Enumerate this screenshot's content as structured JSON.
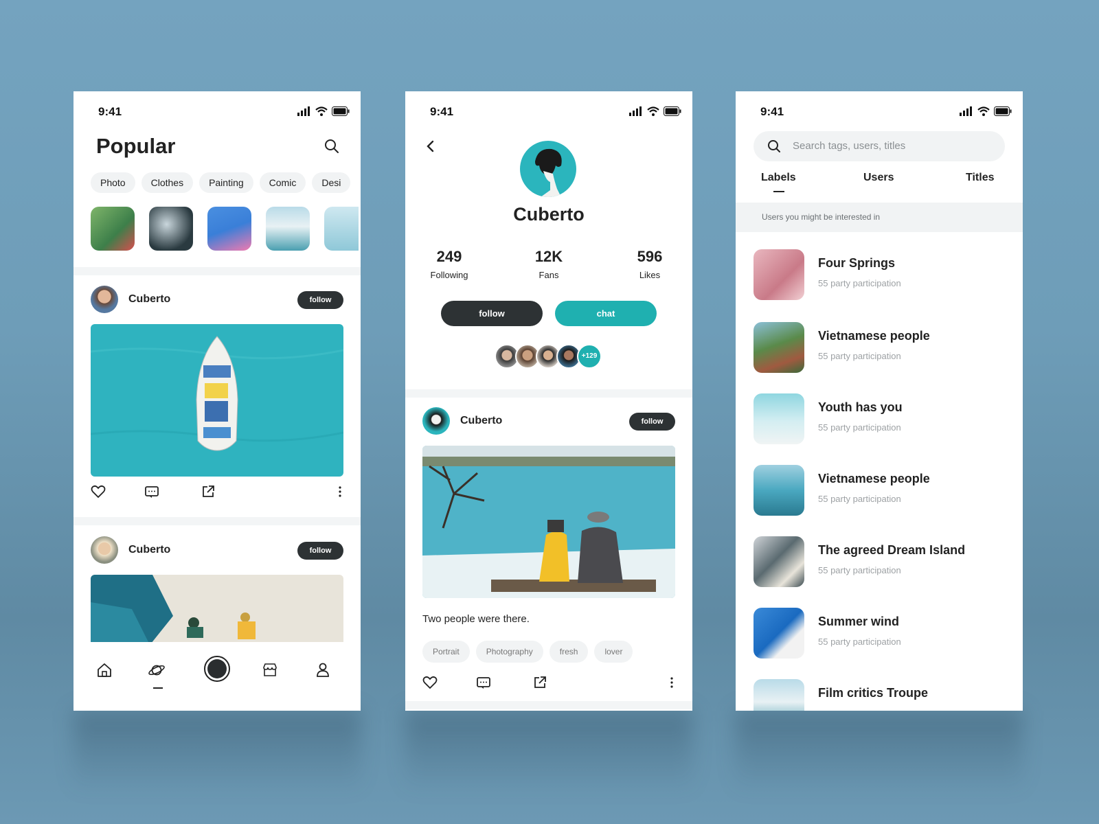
{
  "status": {
    "time": "9:41"
  },
  "screen1": {
    "title": "Popular",
    "chips": [
      "Photo",
      "Clothes",
      "Painting",
      "Comic",
      "Desi"
    ],
    "posts": [
      {
        "name": "Cuberto",
        "follow": "follow"
      },
      {
        "name": "Cuberto",
        "follow": "follow"
      }
    ]
  },
  "screen2": {
    "name": "Cuberto",
    "stats": [
      {
        "value": "249",
        "label": "Following"
      },
      {
        "value": "12K",
        "label": "Fans"
      },
      {
        "value": "596",
        "label": "Likes"
      }
    ],
    "follow_label": "follow",
    "chat_label": "chat",
    "followers_more": "+129",
    "post": {
      "name": "Cuberto",
      "follow": "follow",
      "caption": "Two people were there.",
      "tags": [
        "Portrait",
        "Photography",
        "fresh",
        "lover"
      ]
    }
  },
  "screen3": {
    "search_placeholder": "Search tags, users, titles",
    "tabs": [
      "Labels",
      "Users",
      "Titles"
    ],
    "banner": "Users you might be interested in",
    "items": [
      {
        "title": "Four Springs",
        "sub": "55 party participation"
      },
      {
        "title": "Vietnamese people",
        "sub": "55 party participation"
      },
      {
        "title": "Youth has you",
        "sub": "55 party participation"
      },
      {
        "title": "Vietnamese people",
        "sub": "55 party participation"
      },
      {
        "title": "The agreed Dream Island",
        "sub": "55 party participation"
      },
      {
        "title": "Summer wind",
        "sub": "55 party participation"
      },
      {
        "title": "Film critics Troupe",
        "sub": ""
      }
    ]
  },
  "colors": {
    "accent": "#1fb0b0",
    "dark": "#2d3234",
    "background": "#6e9db8"
  }
}
